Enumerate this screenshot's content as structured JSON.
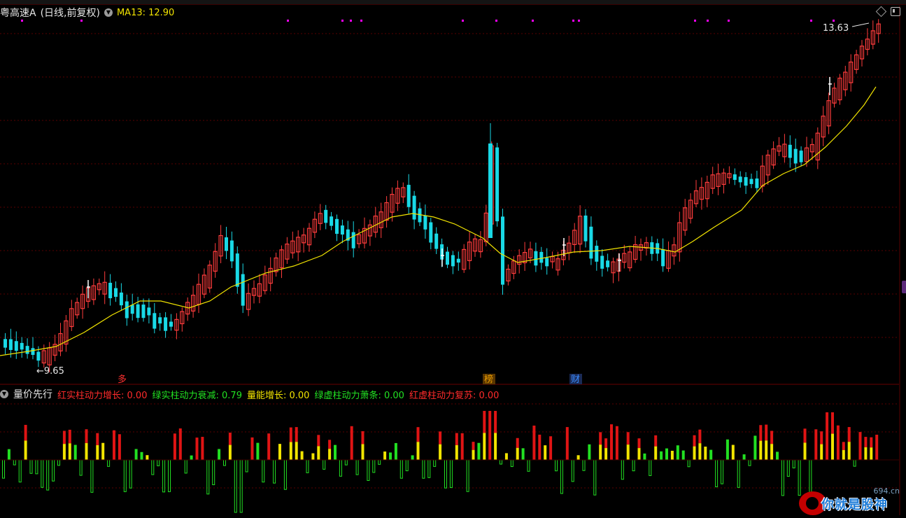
{
  "header": {
    "stock_name": "粤高速A",
    "period": "(日线,前复权)",
    "ma_label": "MA13: 12.90"
  },
  "price_chart": {
    "high_marker": "13.63",
    "low_marker": "9.65",
    "ma_color": "#f2e400",
    "up_color": "#ff3c3c",
    "down_color": "#19d9e6",
    "event_labels": [
      {
        "text": "多",
        "color": "#ff3030"
      },
      {
        "text": "榜",
        "color": "#e69a00"
      },
      {
        "text": "财",
        "color": "#3a8cff"
      }
    ]
  },
  "sub_chart": {
    "name": "量价先行",
    "red_solid": {
      "label": "红实柱动力增长:",
      "value": "0.00",
      "color": "#ff2b2b"
    },
    "green_solid": {
      "label": "绿实柱动力衰减:",
      "value": "0.79",
      "color": "#22e022"
    },
    "volume_up": {
      "label": "量能增长:",
      "value": "0.00",
      "color": "#f2e400"
    },
    "green_hollow": {
      "label": "绿虚柱动力萧条:",
      "value": "0.00",
      "color": "#22e022"
    },
    "red_hollow": {
      "label": "红虚柱动力复苏:",
      "value": "0.00",
      "color": "#ff2b2b"
    }
  },
  "watermark": {
    "site": "694.cn",
    "text": "你就是股神"
  }
}
